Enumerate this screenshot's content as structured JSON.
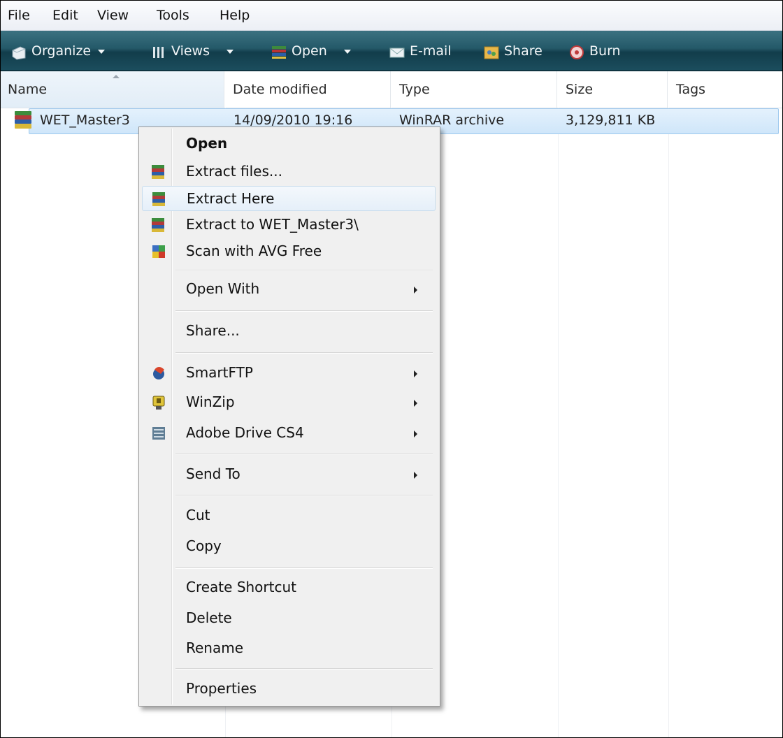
{
  "menubar": {
    "items": [
      "File",
      "Edit",
      "View",
      "Tools",
      "Help"
    ]
  },
  "toolbar": {
    "organize": "Organize",
    "views": "Views",
    "open": "Open",
    "email": "E-mail",
    "share": "Share",
    "burn": "Burn"
  },
  "columns": {
    "name": "Name",
    "date": "Date modified",
    "type": "Type",
    "size": "Size",
    "tags": "Tags"
  },
  "file": {
    "name": "WET_Master3",
    "date": "14/09/2010 19:16",
    "type": "WinRAR archive",
    "size": "3,129,811 KB"
  },
  "context_menu": {
    "open": "Open",
    "extract_files": "Extract files...",
    "extract_here": "Extract Here",
    "extract_to": "Extract to WET_Master3\\",
    "scan_avg": "Scan with AVG Free",
    "open_with": "Open With",
    "share": "Share...",
    "smartftp": "SmartFTP",
    "winzip": "WinZip",
    "adobe_drive": "Adobe Drive CS4",
    "send_to": "Send To",
    "cut": "Cut",
    "copy": "Copy",
    "create_shortcut": "Create Shortcut",
    "delete": "Delete",
    "rename": "Rename",
    "properties": "Properties"
  },
  "colors": {
    "toolbar": "#245968",
    "selection": "#cfe6fa",
    "menu_bg": "#f0f0f0"
  },
  "icons": {
    "file": "winrar-archive-icon",
    "organize": "organize-icon",
    "views": "views-icon",
    "open": "open-icon",
    "email": "email-icon",
    "share": "share-icon",
    "burn": "burn-disc-icon"
  }
}
